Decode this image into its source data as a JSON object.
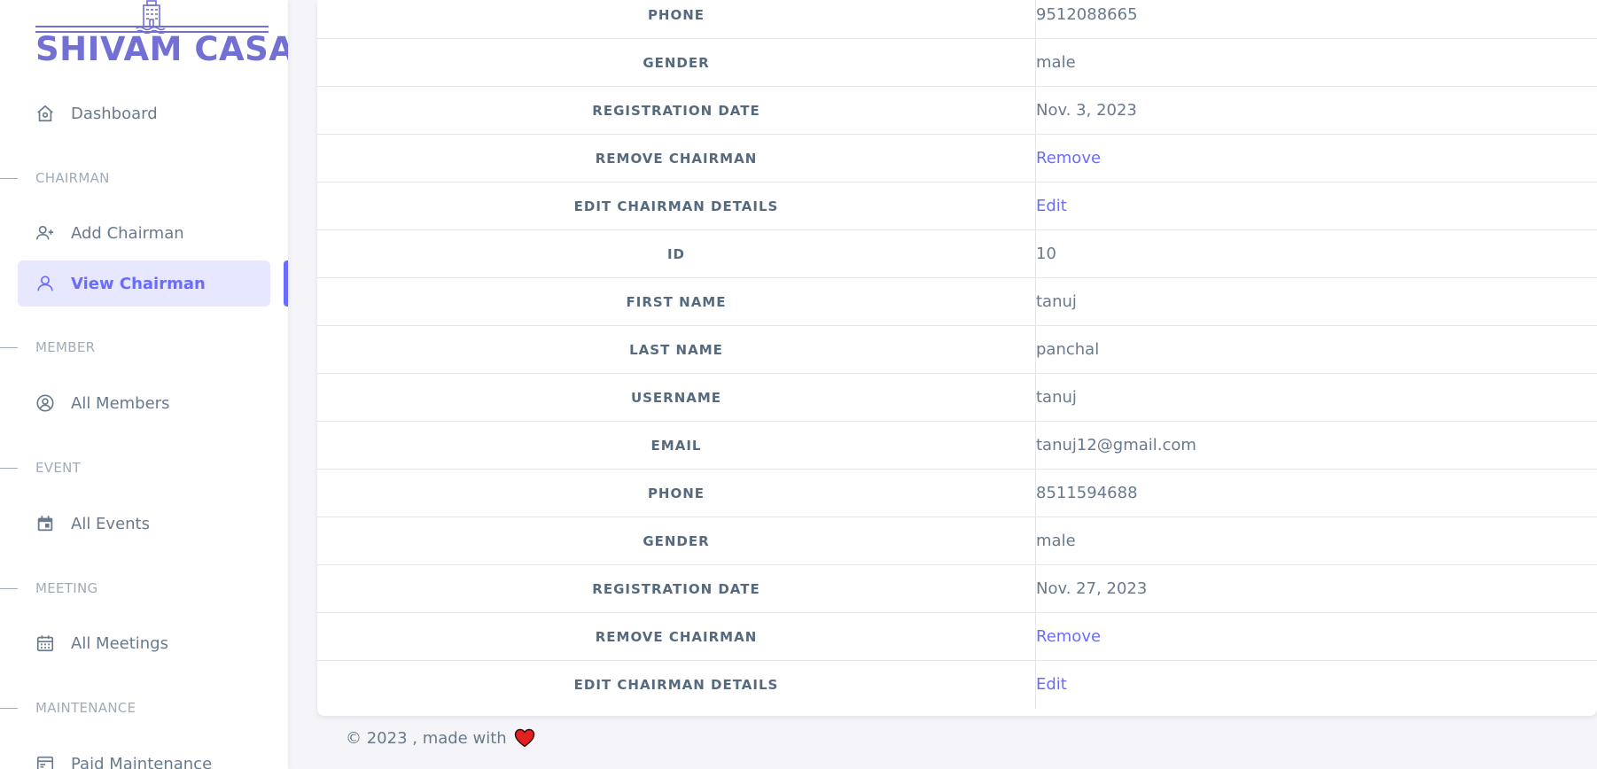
{
  "brand": {
    "name": "SHIVAM CASA"
  },
  "sidebar": {
    "dashboard": {
      "label": "Dashboard",
      "icon": "home-icon"
    },
    "sections": [
      {
        "title": "CHAIRMAN"
      },
      {
        "title": "MEMBER"
      },
      {
        "title": "EVENT"
      },
      {
        "title": "MEETING"
      },
      {
        "title": "MAINTENANCE"
      }
    ],
    "items": [
      {
        "label": "Add Chairman",
        "icon": "user-plus-icon"
      },
      {
        "label": "View Chairman",
        "icon": "user-icon",
        "active": true
      },
      {
        "label": "All Members",
        "icon": "user-circle-icon"
      },
      {
        "label": "All Events",
        "icon": "calendar-event-icon"
      },
      {
        "label": "All Meetings",
        "icon": "calendar-icon"
      },
      {
        "label": "Paid Maintenance",
        "icon": "receipt-icon"
      }
    ]
  },
  "table": {
    "rows": [
      {
        "key": "PHONE",
        "value": "9512088665"
      },
      {
        "key": "GENDER",
        "value": "male"
      },
      {
        "key": "REGISTRATION DATE",
        "value": "Nov. 3, 2023"
      },
      {
        "key": "REMOVE CHAIRMAN",
        "value": "Remove",
        "link": true
      },
      {
        "key": "EDIT CHAIRMAN DETAILS",
        "value": "Edit",
        "link": true
      },
      {
        "key": "ID",
        "value": "10"
      },
      {
        "key": "FIRST NAME",
        "value": "tanuj"
      },
      {
        "key": "LAST NAME",
        "value": "panchal"
      },
      {
        "key": "USERNAME",
        "value": "tanuj"
      },
      {
        "key": "EMAIL",
        "value": "tanuj12@gmail.com"
      },
      {
        "key": "PHONE",
        "value": "8511594688"
      },
      {
        "key": "GENDER",
        "value": "male"
      },
      {
        "key": "REGISTRATION DATE",
        "value": "Nov. 27, 2023"
      },
      {
        "key": "REMOVE CHAIRMAN",
        "value": "Remove",
        "link": true
      },
      {
        "key": "EDIT CHAIRMAN DETAILS",
        "value": "Edit",
        "link": true
      }
    ]
  },
  "footer": {
    "text": "© 2023 , made with",
    "icon": "heart-icon"
  },
  "colors": {
    "accent": "#696cff",
    "brand": "#7270d5",
    "text": "#697a8d",
    "heading": "#566a7f",
    "heart": "#e0211f"
  }
}
